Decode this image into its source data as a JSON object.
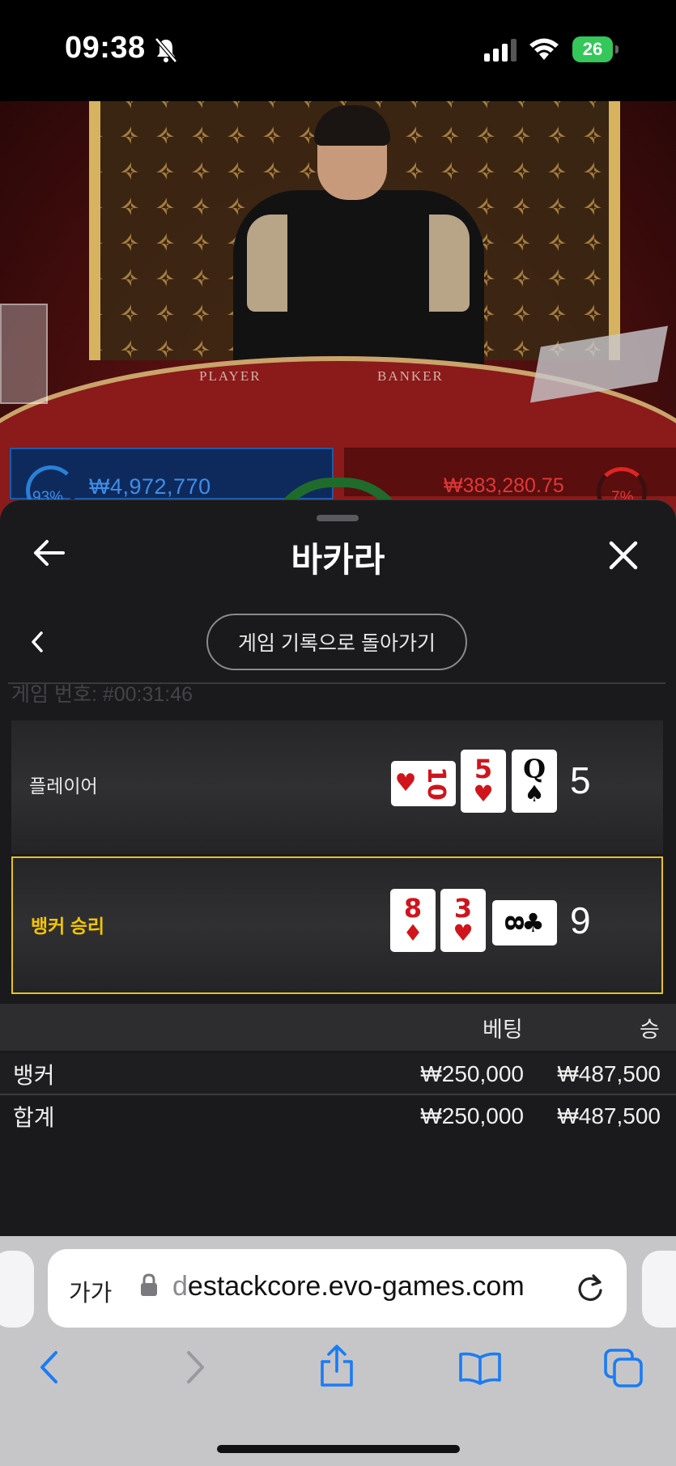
{
  "status_bar": {
    "time": "09:38",
    "battery": "26"
  },
  "video": {
    "table_left_label": "PLAYER",
    "table_right_label": "BANKER",
    "player_amount": "₩4,972,770",
    "player_pct": "93%",
    "banker_amount": "₩383,280.75",
    "banker_pct": "7%"
  },
  "sheet": {
    "title": "바카라",
    "history_button": "게임 기록으로 돌아가기",
    "game_number": "게임 번호: #00:31:46",
    "player": {
      "label": "플레이어",
      "total": "5",
      "cards": [
        {
          "rank": "10",
          "suit": "♥",
          "color": "red",
          "orientation": "sideways"
        },
        {
          "rank": "5",
          "suit": "♥",
          "color": "red",
          "orientation": "upright"
        },
        {
          "rank": "Q",
          "suit": "♠",
          "color": "black",
          "orientation": "upright"
        }
      ]
    },
    "banker": {
      "label": "뱅커 승리",
      "total": "9",
      "highlight_color": "#e6c21e",
      "cards": [
        {
          "rank": "8",
          "suit": "♦",
          "color": "red",
          "orientation": "upright"
        },
        {
          "rank": "3",
          "suit": "♥",
          "color": "red",
          "orientation": "upright"
        },
        {
          "rank": "8",
          "suit": "♣",
          "color": "black",
          "orientation": "sideways"
        }
      ]
    },
    "bets_table": {
      "headers": {
        "bet": "베팅",
        "win": "승"
      },
      "rows": [
        {
          "name": "뱅커",
          "bet": "₩250,000",
          "win": "₩487,500"
        },
        {
          "name": "합계",
          "bet": "₩250,000",
          "win": "₩487,500"
        }
      ]
    }
  },
  "browser": {
    "aa_label": "가가",
    "url_prefix": "d",
    "url": "estackcore.evo-games.com",
    "accent_color": "#1a7cf5"
  }
}
